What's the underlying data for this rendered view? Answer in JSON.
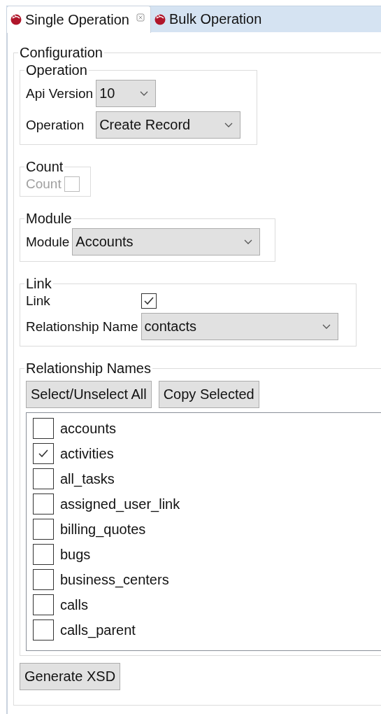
{
  "tabs": [
    {
      "label": "Single Operation",
      "selected": true,
      "closable": true
    },
    {
      "label": "Bulk Operation",
      "selected": false,
      "closable": false
    }
  ],
  "configuration": {
    "title": "Configuration",
    "operation_group": {
      "title": "Operation",
      "fields": [
        {
          "label": "Api Version",
          "value": "10"
        },
        {
          "label": "Operation",
          "value": "Create Record"
        }
      ]
    },
    "count_group": {
      "title": "Count",
      "label": "Count",
      "checked": false,
      "disabled": true
    },
    "module_group": {
      "title": "Module",
      "fields": [
        {
          "label": "Module",
          "value": "Accounts"
        }
      ]
    },
    "link_group": {
      "title": "Link",
      "link": {
        "label": "Link",
        "checked": true
      },
      "relationship_name": {
        "label": "Relationship Name",
        "value": "contacts"
      }
    },
    "relationship_names_group": {
      "title": "Relationship Names",
      "buttons": [
        "Select/Unselect All",
        "Copy Selected"
      ],
      "items": [
        {
          "label": "accounts",
          "checked": false
        },
        {
          "label": "activities",
          "checked": true
        },
        {
          "label": "all_tasks",
          "checked": false
        },
        {
          "label": "assigned_user_link",
          "checked": false
        },
        {
          "label": "billing_quotes",
          "checked": false
        },
        {
          "label": "bugs",
          "checked": false
        },
        {
          "label": "business_centers",
          "checked": false
        },
        {
          "label": "calls",
          "checked": false
        },
        {
          "label": "calls_parent",
          "checked": false
        }
      ]
    },
    "generate_button": "Generate XSD"
  }
}
